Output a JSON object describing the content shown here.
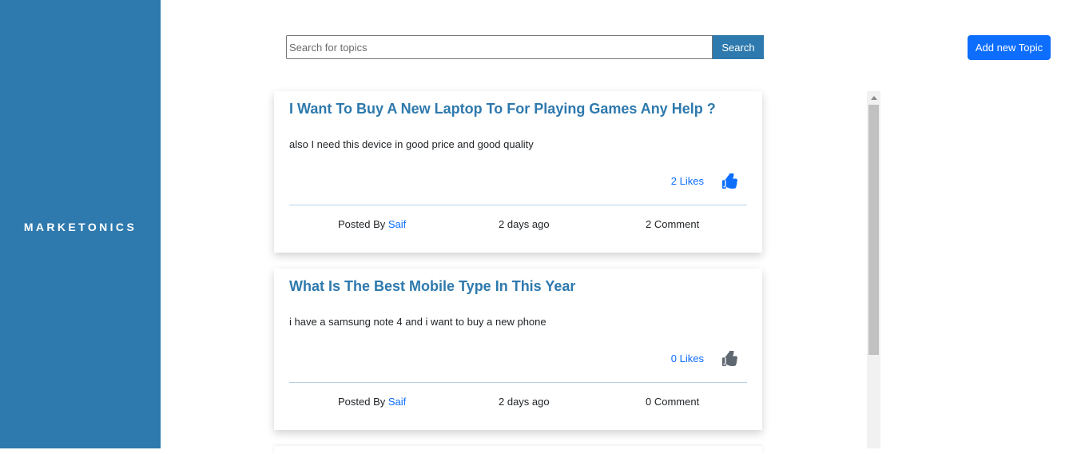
{
  "sidebar": {
    "brand": "MARKETONICS"
  },
  "search": {
    "placeholder": "Search for topics",
    "value": "",
    "button_label": "Search"
  },
  "header": {
    "add_button_label": "Add new Topic"
  },
  "posts": [
    {
      "title": "I Want To Buy A New Laptop To For Playing Games Any Help ?",
      "body": "also I need this device in good price and good quality",
      "likes": "2 Likes",
      "liked": true,
      "posted_by_label": "Posted By",
      "author": "Saif",
      "time": "2 days ago",
      "comments": "2 Comment"
    },
    {
      "title": "What Is The Best Mobile Type In This Year",
      "body": "i have a samsung note 4 and i want to buy a new phone",
      "likes": "0 Likes",
      "liked": false,
      "posted_by_label": "Posted By",
      "author": "Saif",
      "time": "2 days ago",
      "comments": "0 Comment"
    }
  ],
  "colors": {
    "brand": "#2e79ad",
    "link": "#0d6efd",
    "like_active": "#0d6efd",
    "like_inactive": "#5f6770"
  },
  "icons": {
    "like": "thumbs-up-icon"
  }
}
